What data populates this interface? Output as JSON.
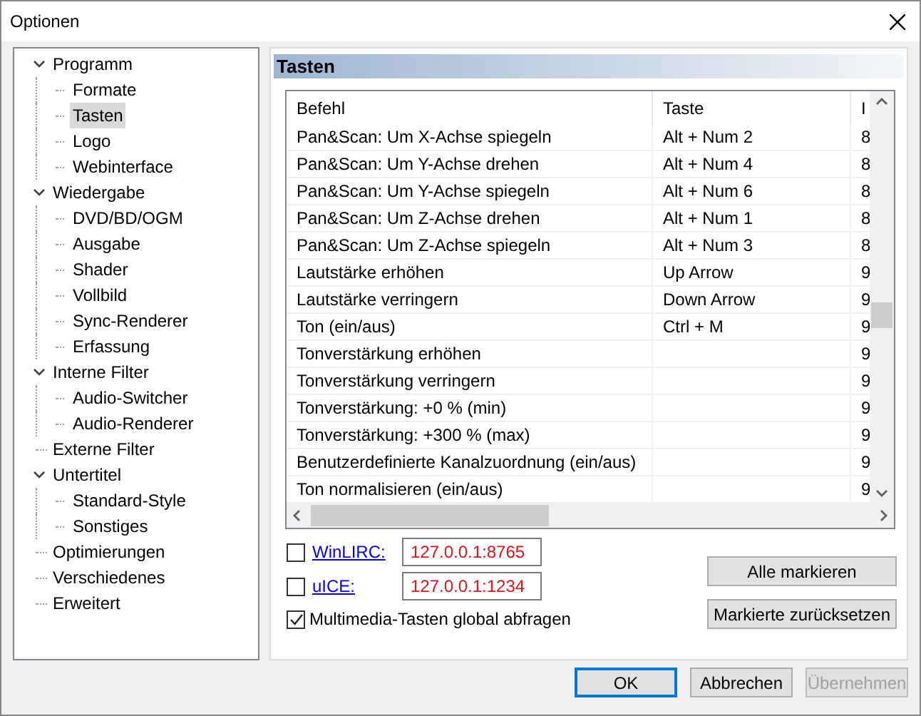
{
  "window": {
    "title": "Optionen"
  },
  "tree": [
    {
      "label": "Programm",
      "selected": false,
      "expanded": true,
      "children": [
        {
          "label": "Formate",
          "selected": false
        },
        {
          "label": "Tasten",
          "selected": true
        },
        {
          "label": "Logo",
          "selected": false
        },
        {
          "label": "Webinterface",
          "selected": false
        }
      ]
    },
    {
      "label": "Wiedergabe",
      "selected": false,
      "expanded": true,
      "children": [
        {
          "label": "DVD/BD/OGM",
          "selected": false
        },
        {
          "label": "Ausgabe",
          "selected": false
        },
        {
          "label": "Shader",
          "selected": false
        },
        {
          "label": "Vollbild",
          "selected": false
        },
        {
          "label": "Sync-Renderer",
          "selected": false
        },
        {
          "label": "Erfassung",
          "selected": false
        }
      ]
    },
    {
      "label": "Interne Filter",
      "selected": false,
      "expanded": true,
      "children": [
        {
          "label": "Audio-Switcher",
          "selected": false
        },
        {
          "label": "Audio-Renderer",
          "selected": false
        }
      ]
    },
    {
      "label": "Externe Filter",
      "selected": false
    },
    {
      "label": "Untertitel",
      "selected": false,
      "expanded": true,
      "children": [
        {
          "label": "Standard-Style",
          "selected": false
        },
        {
          "label": "Sonstiges",
          "selected": false
        }
      ]
    },
    {
      "label": "Optimierungen",
      "selected": false
    },
    {
      "label": "Verschiedenes",
      "selected": false
    },
    {
      "label": "Erweitert",
      "selected": false
    }
  ],
  "page": {
    "title": "Tasten",
    "table": {
      "columns": [
        "Befehl",
        "Taste",
        "I"
      ],
      "rows": [
        [
          "Pan&Scan: Um X-Achse spiegeln",
          "Alt + Num 2",
          "8"
        ],
        [
          "Pan&Scan: Um Y-Achse drehen",
          "Alt + Num 4",
          "8"
        ],
        [
          "Pan&Scan: Um Y-Achse spiegeln",
          "Alt + Num 6",
          "8"
        ],
        [
          "Pan&Scan: Um Z-Achse drehen",
          "Alt + Num 1",
          "8"
        ],
        [
          "Pan&Scan: Um Z-Achse spiegeln",
          "Alt + Num 3",
          "8"
        ],
        [
          "Lautstärke erhöhen",
          "Up Arrow",
          "9"
        ],
        [
          "Lautstärke verringern",
          "Down Arrow",
          "9"
        ],
        [
          "Ton (ein/aus)",
          "Ctrl + M",
          "9"
        ],
        [
          "Tonverstärkung erhöhen",
          "",
          "9"
        ],
        [
          "Tonverstärkung verringern",
          "",
          "9"
        ],
        [
          "Tonverstärkung: +0 % (min)",
          "",
          "9"
        ],
        [
          "Tonverstärkung: +300 % (max)",
          "",
          "9"
        ],
        [
          "Benutzerdefinierte Kanalzuordnung (ein/aus)",
          "",
          "9"
        ],
        [
          "Ton normalisieren (ein/aus)",
          "",
          "9"
        ]
      ]
    },
    "remotes": [
      {
        "label": "WinLIRC:",
        "checked": false,
        "value": "127.0.0.1:8765"
      },
      {
        "label": "uICE:",
        "checked": false,
        "value": "127.0.0.1:1234"
      }
    ],
    "global_keys": {
      "label": "Multimedia-Tasten global abfragen",
      "checked": true
    },
    "actions": [
      "Alle markieren",
      "Markierte zurücksetzen"
    ]
  },
  "buttons": [
    {
      "label": "OK",
      "default": true,
      "disabled": false
    },
    {
      "label": "Abbrechen",
      "default": false,
      "disabled": false
    },
    {
      "label": "Übernehmen",
      "default": false,
      "disabled": true
    }
  ]
}
